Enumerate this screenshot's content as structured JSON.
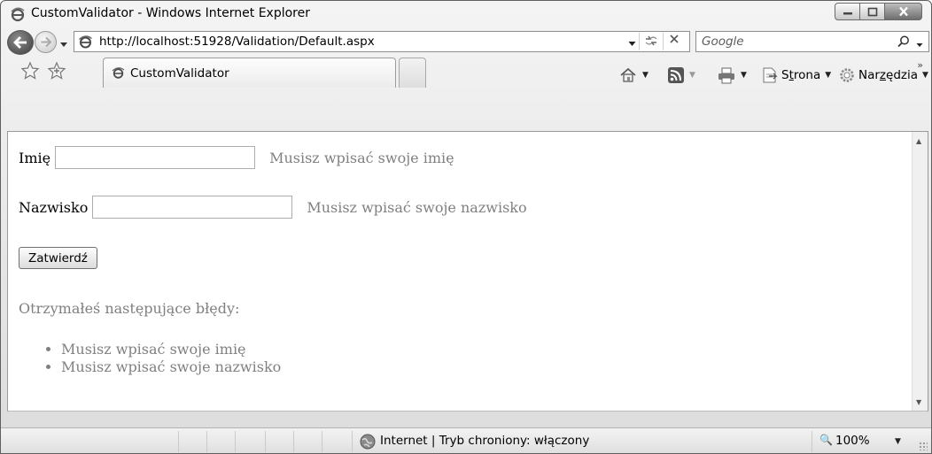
{
  "window": {
    "title": "CustomValidator - Windows Internet Explorer"
  },
  "address_bar": {
    "url": "http://localhost:51928/Validation/Default.aspx",
    "search_placeholder": "Google"
  },
  "tabs": [
    {
      "label": "CustomValidator",
      "active": true
    }
  ],
  "command_bar": {
    "page_menu": {
      "accel": "t",
      "before": "S",
      "after": "rona"
    },
    "tools_menu": {
      "before": "Nar",
      "accel": "z",
      "after": "ędzia"
    }
  },
  "page": {
    "first_name_label": "Imię",
    "first_name_value": "",
    "first_name_error": "Musisz wpisać swoje imię",
    "last_name_label": "Nazwisko",
    "last_name_value": "",
    "last_name_error": "Musisz wpisać swoje nazwisko",
    "submit_label": "Zatwierdź",
    "summary_heading": "Otrzymałeś następujące błędy:",
    "summary_items": [
      "Musisz wpisać swoje imię",
      "Musisz wpisać swoje nazwisko"
    ]
  },
  "status_bar": {
    "zone_text": "Internet | Tryb chroniony: włączony",
    "zoom_text": "100%"
  },
  "colors": {
    "validator_text": "#808080"
  },
  "icons": [
    "ie-page-icon",
    "back-arrow-icon",
    "forward-arrow-icon",
    "refresh-icon",
    "stop-icon",
    "search-icon",
    "favorites-star-icon",
    "add-favorites-icon",
    "home-icon",
    "rss-feed-icon",
    "print-icon",
    "page-icon",
    "tools-gear-icon",
    "globe-icon",
    "zoom-icon"
  ]
}
